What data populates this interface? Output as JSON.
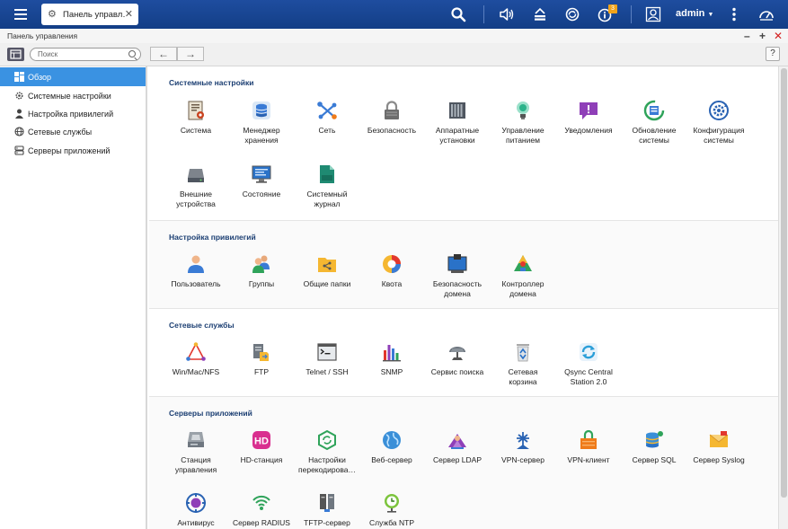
{
  "header": {
    "tab_label": "Панель управл…",
    "user": "admin",
    "notification_count": "3"
  },
  "window": {
    "title": "Панель управления"
  },
  "toolbar": {
    "search_placeholder": "Поиск",
    "help": "?"
  },
  "sidebar": {
    "items": [
      {
        "label": "Обзор",
        "icon": "grid-icon"
      },
      {
        "label": "Системные настройки",
        "icon": "gear-icon"
      },
      {
        "label": "Настройка привилегий",
        "icon": "user-icon"
      },
      {
        "label": "Сетевые службы",
        "icon": "globe-icon"
      },
      {
        "label": "Серверы приложений",
        "icon": "server-icon"
      }
    ]
  },
  "sections": [
    {
      "title": "Системные настройки",
      "items": [
        {
          "label": "Система",
          "icon": "system-icon"
        },
        {
          "label": "Менеджер\nхранения",
          "icon": "storage-icon"
        },
        {
          "label": "Сеть",
          "icon": "network-icon"
        },
        {
          "label": "Безопасность",
          "icon": "lock-icon"
        },
        {
          "label": "Аппаратные\nустановки",
          "icon": "hardware-icon"
        },
        {
          "label": "Управление\nпитанием",
          "icon": "power-icon"
        },
        {
          "label": "Уведомления",
          "icon": "notification-icon"
        },
        {
          "label": "Обновление\nсистемы",
          "icon": "update-icon"
        },
        {
          "label": "Конфигурация\nсистемы",
          "icon": "config-icon"
        },
        {
          "label": "Внешние\nустройства",
          "icon": "external-device-icon"
        },
        {
          "label": "Состояние",
          "icon": "status-icon"
        },
        {
          "label": "Системный\nжурнал",
          "icon": "log-icon"
        }
      ]
    },
    {
      "title": "Настройка привилегий",
      "items": [
        {
          "label": "Пользователь",
          "icon": "user-icon"
        },
        {
          "label": "Группы",
          "icon": "group-icon"
        },
        {
          "label": "Общие папки",
          "icon": "shared-folder-icon"
        },
        {
          "label": "Квота",
          "icon": "quota-icon"
        },
        {
          "label": "Безопасность\nдомена",
          "icon": "domain-security-icon"
        },
        {
          "label": "Контроллер\nдомена",
          "icon": "domain-controller-icon"
        }
      ]
    },
    {
      "title": "Сетевые службы",
      "items": [
        {
          "label": "Win/Mac/NFS",
          "icon": "win-mac-nfs-icon"
        },
        {
          "label": "FTP",
          "icon": "ftp-icon"
        },
        {
          "label": "Telnet / SSH",
          "icon": "terminal-icon"
        },
        {
          "label": "SNMP",
          "icon": "snmp-icon"
        },
        {
          "label": "Сервис поиска",
          "icon": "discovery-icon"
        },
        {
          "label": "Сетевая\nкорзина",
          "icon": "recycle-bin-icon"
        },
        {
          "label": "Qsync Central\nStation 2.0",
          "icon": "qsync-icon"
        }
      ]
    },
    {
      "title": "Серверы приложений",
      "items": [
        {
          "label": "Станция\nуправления",
          "icon": "station-manager-icon"
        },
        {
          "label": "HD-станция",
          "icon": "hd-station-icon"
        },
        {
          "label": "Настройки\nперекодирова…",
          "icon": "transcode-icon"
        },
        {
          "label": "Веб-сервер",
          "icon": "web-server-icon"
        },
        {
          "label": "Сервер LDAP",
          "icon": "ldap-icon"
        },
        {
          "label": "VPN-сервер",
          "icon": "vpn-server-icon"
        },
        {
          "label": "VPN-клиент",
          "icon": "vpn-client-icon"
        },
        {
          "label": "Сервер SQL",
          "icon": "sql-icon"
        },
        {
          "label": "Сервер Syslog",
          "icon": "syslog-icon"
        },
        {
          "label": "Антивирус",
          "icon": "antivirus-icon"
        },
        {
          "label": "Сервер RADIUS",
          "icon": "radius-icon"
        },
        {
          "label": "TFTP-сервер",
          "icon": "tftp-icon"
        },
        {
          "label": "Служба NTP",
          "icon": "ntp-icon"
        }
      ]
    }
  ]
}
